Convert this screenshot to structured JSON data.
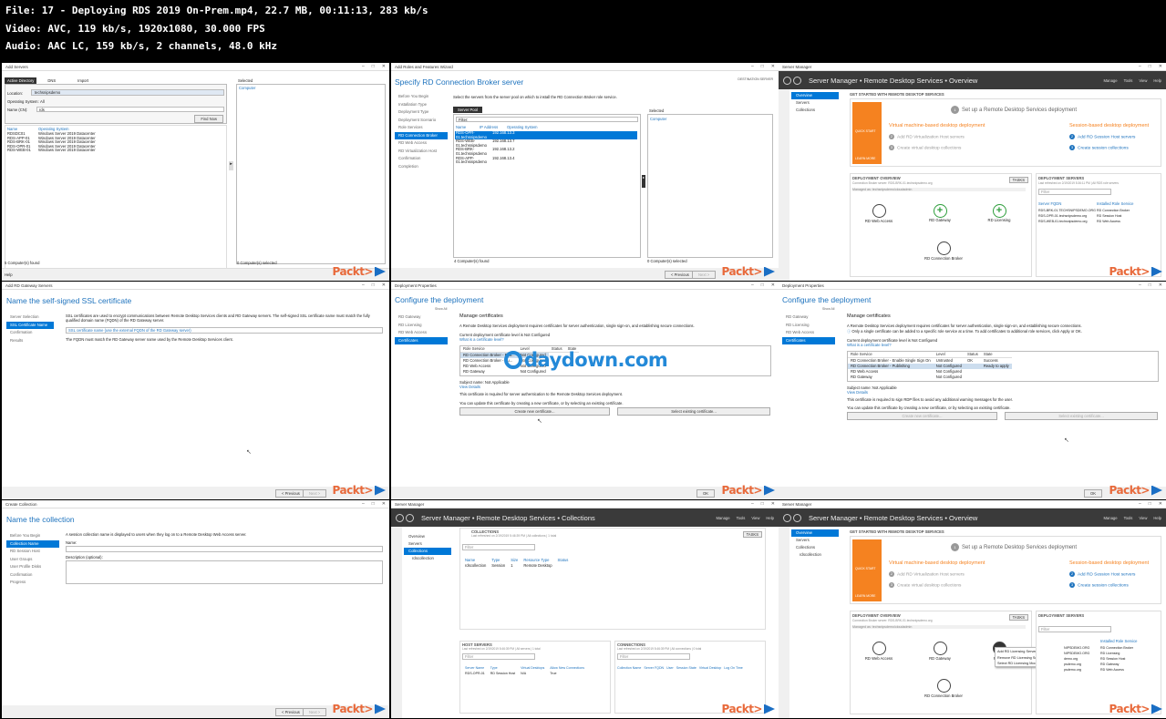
{
  "header": {
    "line1": "File: 17 - Deploying RDS 2019 On-Prem.mp4, 22.7 MB, 00:11:13, 283 kb/s",
    "line2": "Video: AVC, 119 kb/s, 1920x1080, 30.000 FPS",
    "line3": "Audio: AAC LC, 159 kb/s, 2 channels, 48.0 kHz"
  },
  "watermark": "daydown.com",
  "packt": "Packt>",
  "t1": {
    "title": "Add Servers",
    "tabs": [
      "Active Directory",
      "DNS",
      "Import"
    ],
    "location_label": "Location:",
    "location_value": "techsnipsdemo",
    "os_label": "Operating System:",
    "os_value": "All",
    "name_label": "Name (CN):",
    "name_value": "rds",
    "find_now": "Find Now",
    "col_name": "Name",
    "col_os": "Operating System",
    "rows": [
      [
        "RDSDC01",
        "Windows Server 2019 Datacenter"
      ],
      [
        "RDS-APP-01",
        "Windows Server 2019 Datacenter"
      ],
      [
        "RDS-BRK-01",
        "Windows Server 2019 Datacenter"
      ],
      [
        "RDS-OPR-01",
        "Windows Server 2019 Datacenter"
      ],
      [
        "RDS-WEB-01",
        "Windows Server 2019 Datacenter"
      ]
    ],
    "selected": "Selected",
    "computer": "Computer",
    "found": "5 Computer(s) found",
    "sel": "0 Computer(s) selected",
    "help": "Help"
  },
  "t2": {
    "title": "Add Roles and Features Wizard",
    "heading": "Specify RD Connection Broker server",
    "dest": "DESTINATION SERVER",
    "nav": [
      "Before You Begin",
      "Installation Type",
      "Deployment Type",
      "Deployment Scenario",
      "Role Services",
      "RD Connection Broker",
      "RD Web Access",
      "RD Virtualization Host",
      "Confirmation",
      "Completion"
    ],
    "desc": "Select the servers from the server pool on which to install the RD Connection Broker role service.",
    "pool": "Server Pool",
    "filter": "Filter:",
    "cols": [
      "Name",
      "IP Address",
      "Operating System"
    ],
    "rows": [
      [
        "RDS-OPR-01.techsnipsdemo",
        "192.168.13.3"
      ],
      [
        "RDS-WEB-01.techsnipsdemo",
        "192.168.13.7"
      ],
      [
        "RDS-BRK-01.techsnipsdemo",
        "192.168.13.2"
      ],
      [
        "RDS-APP-01.techsnipsdemo",
        "192.168.13.4"
      ]
    ],
    "selected": "Selected",
    "computer": "Computer",
    "found": "4 Computer(s) found",
    "sel": "0 Computer(s) selected",
    "prev": "< Previous",
    "next": "Next >"
  },
  "t3": {
    "title": "Server Manager",
    "crumb": "Server Manager • Remote Desktop Services • Overview",
    "menu": [
      "Manage",
      "Tools",
      "View",
      "Help"
    ],
    "left": [
      "Overview",
      "Servers",
      "Collections"
    ],
    "started": "GET STARTED WITH REMOTE DESKTOP SERVICES",
    "quick": "QUICK START",
    "learn": "LEARN MORE",
    "step1": "Set up a Remote Desktop Services deployment",
    "vm": "Virtual machine-based desktop deployment",
    "session": "Session-based desktop deployment",
    "vm2": "Add RD Virtualization Host servers",
    "vm3": "Create virtual desktop collections",
    "s2": "Add RD Session Host servers",
    "s3": "Create session collections",
    "n1": "1",
    "n2": "2",
    "n3": "3",
    "ov": "DEPLOYMENT OVERVIEW",
    "ovsub": "Connection Broker server: RDS-BRK-01.techsnipsdemo.org",
    "managed": "Managed as: techsnipsdemo\\cloudadmin",
    "tasks": "TASKS",
    "webaccess": "RD Web Access",
    "gateway": "RD Gateway",
    "licensing": "RD Licensing",
    "broker": "RD Connection Broker",
    "ds": "DEPLOYMENT SERVERS",
    "dssub": "Last refreshed on 2/19/2019 5:36:11 PM | All RDS role servers",
    "filter": "Filter",
    "dcol1": "Server FQDN",
    "dcol2": "Installed Role Service",
    "drows": [
      [
        "RDS-BRK-01.TECHSNIPSDEMO.ORG",
        "RD Connection Broker"
      ],
      [
        "RDS-OPR-01.techsnipsdemo.org",
        "RD Session Host"
      ],
      [
        "RDS-WEB-01.techsnipsdemo.org",
        "RD Web Access"
      ]
    ]
  },
  "t4": {
    "title": "Add RD Gateway Servers",
    "heading": "Name the self-signed SSL certificate",
    "nav": [
      "Server Selection",
      "SSL Certificate Name",
      "Confirmation",
      "Results"
    ],
    "desc": "SSL certificates are used to encrypt communications between Remote Desktop Services clients and RD Gateway servers. The self-signed SSL certificate name must match the fully qualified domain name (FQDN) of the RD Gateway server.",
    "placeholder": "SSL certificate name (use the external FQDN of the RD Gateway server)",
    "note": "The FQDN must match the RD Gateway server name used by the Remote Desktop Services client.",
    "prev": "< Previous",
    "next": "Next >"
  },
  "t5": {
    "title": "Deployment Properties",
    "heading": "Configure the deployment",
    "showall": "Show All",
    "nav": [
      "RD Gateway",
      "RD Licensing",
      "RD Web Access",
      "Certificates"
    ],
    "mc": "Manage certificates",
    "desc": "A Remote Desktop Services deployment requires certificates for server authentication, single sign-on, and establishing secure connections.",
    "level": "Current deployment certificate level is Not Configured",
    "what": "What is a certificate level?",
    "cols": [
      "Role Service",
      "Level",
      "Status",
      "State"
    ],
    "rows": [
      [
        "RD Connection Broker - Ena...",
        "Not Configured"
      ],
      [
        "RD Connection Broker - Pu...",
        "Not Configured"
      ],
      [
        "RD Web Access",
        "Not Configured"
      ],
      [
        "RD Gateway",
        "Not Configured"
      ]
    ],
    "subject": "Subject name: Not Applicable",
    "view": "View Details",
    "req": "This certificate is required for server authentication to the Remote Desktop Services deployment.",
    "upd": "You can update this certificate by creating a new certificate, or by selecting an existing certificate.",
    "create": "Create new certificate...",
    "select": "Select existing certificate...",
    "ok": "OK",
    "cancel": "Cancel",
    "apply": "Apply"
  },
  "t6": {
    "title": "Deployment Properties",
    "heading": "Configure the deployment",
    "showall": "Show All",
    "nav": [
      "RD Gateway",
      "RD Licensing",
      "RD Web Access",
      "Certificates"
    ],
    "mc": "Manage certificates",
    "desc": "A Remote Desktop Services deployment requires certificates for server authentication, single sign-on, and establishing secure connections.",
    "warn": "Only a single certificate can be added to a specific role service at a time. To add certificates to additional role services, click Apply or OK.",
    "level": "Current deployment certificate level is Not Configured",
    "what": "What is a certificate level?",
    "cols": [
      "Role Service",
      "Level",
      "Status",
      "State"
    ],
    "rows": [
      [
        "RD Connection Broker - Enable Single Sign On",
        "Untrusted",
        "OK",
        "Success"
      ],
      [
        "RD Connection Broker - Publishing",
        "Not Configured",
        "",
        "Ready to apply"
      ],
      [
        "RD Web Access",
        "Not Configured",
        "",
        ""
      ],
      [
        "RD Gateway",
        "Not Configured",
        "",
        ""
      ]
    ],
    "subject": "Subject name: Not Applicable",
    "view": "View Details",
    "req": "This certificate is required to sign RDP files to avoid any additional warning messages for the user.",
    "upd": "You can update this certificate by creating a new certificate, or by selecting an existing certificate.",
    "create": "Create new certificate...",
    "select": "Select existing certificate...",
    "ok": "OK",
    "cancel": "Cancel",
    "apply": "Apply"
  },
  "t7": {
    "title": "Create Collection",
    "heading": "Name the collection",
    "nav": [
      "Before You Begin",
      "Collection Name",
      "RD Session Host",
      "User Groups",
      "User Profile Disks",
      "Confirmation",
      "Progress"
    ],
    "desc": "A session collection name is displayed to users when they log on to a Remote Desktop Web Access server.",
    "name": "Name:",
    "descopt": "Description (optional):",
    "prev": "< Previous",
    "next": "Next >"
  },
  "t8": {
    "title": "Server Manager",
    "crumb": "Server Manager • Remote Desktop Services • Collections",
    "menu": [
      "Manage",
      "Tools",
      "View",
      "Help"
    ],
    "left": [
      "Overview",
      "Servers",
      "Collections",
      "rdscollection"
    ],
    "coll": "COLLECTIONS",
    "collsub": "Last refreshed on 2/19/2019 5:46:39 PM | All collections | 1 total",
    "tasks": "TASKS",
    "filter": "Filter",
    "cols": [
      "Name",
      "Type",
      "Size",
      "Resource Type",
      "Status"
    ],
    "row": [
      "rdscollection",
      "Session",
      "1",
      "Remote Desktop",
      ""
    ],
    "hs": "HOST SERVERS",
    "hssub": "Last refreshed on 2/19/2019 5:46:39 PM | All servers | 1 total",
    "hcols": [
      "Server Name",
      "Type",
      "Virtual Desktops",
      "Allow New Connections"
    ],
    "hrow": [
      "RDS-OPR-01",
      "RD Session Host",
      "N/A",
      "True"
    ],
    "cn": "CONNECTIONS",
    "cnsub": "Last refreshed on 2/19/2019 5:46:39 PM | All connections | 0 total",
    "ccols": [
      "Collection Name",
      "Server FQDN",
      "User",
      "Session State",
      "Virtual Desktop",
      "Log On Time"
    ]
  },
  "t9": {
    "title": "Server Manager",
    "crumb": "Server Manager • Remote Desktop Services • Overview",
    "menu": [
      "Manage",
      "Tools",
      "View",
      "Help"
    ],
    "left": [
      "Overview",
      "Servers",
      "Collections",
      "rdscollection"
    ],
    "started": "GET STARTED WITH REMOTE DESKTOP SERVICES",
    "quick": "QUICK START",
    "learn": "LEARN MORE",
    "step1": "Set up a Remote Desktop Services deployment",
    "vm": "Virtual machine-based desktop deployment",
    "session": "Session-based desktop deployment",
    "vm2": "Add RD Virtualization Host servers",
    "vm3": "Create virtual desktop collections",
    "s2": "Add RD Session Host servers",
    "s3": "Create session collections",
    "n1": "1",
    "n2": "2",
    "n3": "3",
    "ov": "DEPLOYMENT OVERVIEW",
    "ovsub": "Connection Broker server: RDS-BRK-01.techsnipsdemo.org",
    "managed": "Managed as: techsnipsdemo\\cloudadmin",
    "tasks": "TASKS",
    "webaccess": "RD Web Access",
    "gateway": "RD Gateway",
    "licensing": "RD Lic",
    "broker": "RD Connection Broker",
    "ctx": [
      "Add RD Licensing Servers",
      "Remove RD Licensing Servers",
      "Select RD Licensing Mode"
    ],
    "ds": "DEPLOYMENT SERVERS",
    "filter": "Filter",
    "dcol2": "Installed Role Service",
    "drows": [
      "RD Connection Broker",
      "RD Licensing",
      "RD Session Host",
      "RD Gateway",
      "RD Web Access"
    ],
    "dfqdn": [
      "NIPSDEMO.ORG",
      "NIPSDEMO.ORG",
      "demo.org",
      "psdemo.org",
      "psdemo.org"
    ]
  }
}
